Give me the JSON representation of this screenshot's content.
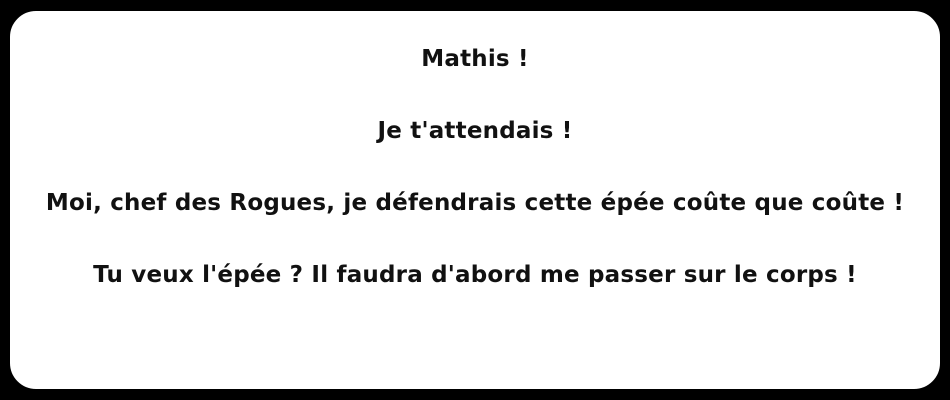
{
  "dialog": {
    "lines": [
      "Mathis !",
      "Je t'attendais !",
      "Moi, chef des Rogues, je défendrais cette épée coûte que coûte !",
      "Tu veux l'épée ? Il faudra d'abord me passer sur le corps !"
    ]
  },
  "colors": {
    "background": "#000000",
    "box_fill": "#ffffff",
    "box_border": "#000000",
    "text": "#111111"
  }
}
